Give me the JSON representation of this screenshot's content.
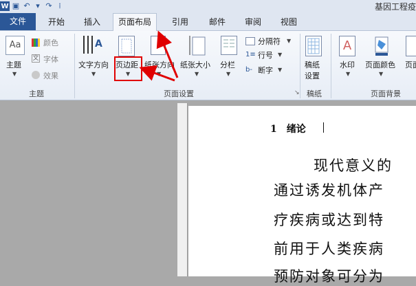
{
  "window": {
    "title": "基因工程疫"
  },
  "tabs": {
    "file": "文件",
    "home": "开始",
    "insert": "插入",
    "page_layout": "页面布局",
    "references": "引用",
    "mailings": "邮件",
    "review": "审阅",
    "view": "视图"
  },
  "ribbon": {
    "themes": {
      "theme": "主题",
      "colors": "颜色",
      "fonts": "字体",
      "effects": "效果",
      "group": "主题"
    },
    "page_setup": {
      "text_direction": "文字方向",
      "margins": "页边距",
      "orientation": "纸张方向",
      "size": "纸张大小",
      "columns": "分栏",
      "breaks": "分隔符",
      "line_numbers": "行号",
      "hyphenation": "断字",
      "group": "页面设置"
    },
    "draft": {
      "draft_settings_line1": "稿纸",
      "draft_settings_line2": "设置",
      "group": "稿纸"
    },
    "page_background": {
      "watermark": "水印",
      "page_color": "页面颜色",
      "page_borders": "页面",
      "group": "页面背景"
    }
  },
  "document": {
    "heading": "1　绪论",
    "lines": [
      "现代意义的",
      "通过诱发机体产",
      "疗疾病或达到特",
      "前用于人类疾病",
      "预防对象可分为"
    ]
  },
  "colors": {
    "accent": "#2b5797",
    "highlight": "#e00000"
  }
}
